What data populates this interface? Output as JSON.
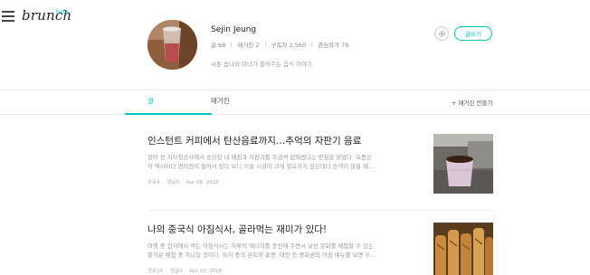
{
  "header": {
    "logo_text": "brunch",
    "logo_badge": "beta"
  },
  "profile": {
    "name": "Sejin Jeung",
    "stats": [
      {
        "label": "글",
        "value": "68"
      },
      {
        "label": "매거진",
        "value": "2"
      },
      {
        "label": "구독자",
        "value": "2,560"
      },
      {
        "label": "관심작가",
        "value": "78"
      }
    ],
    "bio": "서툰 솜나라 마녀가 들려주는 음식 이야기",
    "write_button": "글쓰기"
  },
  "tabs": {
    "posts": "글",
    "magazine": "매거진",
    "make_magazine": "+ 매거진 만들기"
  },
  "articles": [
    {
      "title": "인스턴트 커피에서 탄산음료까지…추억의 자판기 음료",
      "excerpt_lines": [
        "얼마 전 지하철공사에서 승강장 내 매점과 자판기를 조금씩 없애겠다는 방침을 밝혔다. 요즘은",
        "각 역사마다 편의점이 들어서 있다 보니 이들 시설이 크게 필요하지 않은데다 승객이 많을 때..."
      ],
      "comments": "공유4",
      "replies": "댓글0",
      "date": "Apr 06. 2018"
    },
    {
      "title": "나의 중국식 아침식사, 골라먹는 재미가 있다!",
      "excerpt_lines": [
        "여행 중 현지에서 먹는 아침식사는 하루의 에너지를 충전해 주면서 낯선 문화를 체험할 수 있는",
        "즐거운 체험 중 하나일 것이다. 특히 중국 본토와 홍콩, 대만 등 중화권의 아침 메뉴를 보면 우..."
      ],
      "comments": "공유16",
      "replies": "댓글0",
      "date": "Apr 03. 2018"
    }
  ]
}
